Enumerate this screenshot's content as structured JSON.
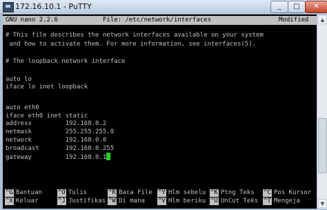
{
  "window": {
    "title": "172.16.10.1 - PuTTY",
    "minimize": "_",
    "maximize": "□",
    "close": "✕"
  },
  "nano_header": {
    "version": "GNU nano 2.2.6",
    "file": "File: /etc/network/interfaces",
    "status": "Modified"
  },
  "editor_lines": [
    "# This file describes the network interfaces available on your system",
    " and how to activate them. For more information, see interfaces(5).",
    "",
    "# The loopback network interface",
    "",
    "auto lo",
    "iface lo inet loopback",
    "",
    "",
    "auto eth0",
    "iface eth0 inet static",
    "address         192.168.0.2",
    "netmask         255.255.255.0",
    "network         192.168.0.0",
    "broadcast       192.168.0.255",
    "gateway         192.168.0.1"
  ],
  "shortcuts_row1": [
    {
      "key": "^G",
      "label": "Bantuan"
    },
    {
      "key": "^O",
      "label": "Tulis"
    },
    {
      "key": "^R",
      "label": "Baca File"
    },
    {
      "key": "^Y",
      "label": "Hlm sebelu"
    },
    {
      "key": "^K",
      "label": "Ptng Teks"
    },
    {
      "key": "^C",
      "label": "Pos Kursor"
    }
  ],
  "shortcuts_row2": [
    {
      "key": "^X",
      "label": "Keluar"
    },
    {
      "key": "^J",
      "label": "Justifikas"
    },
    {
      "key": "^W",
      "label": "Di mana"
    },
    {
      "key": "^V",
      "label": "Hlm beriku"
    },
    {
      "key": "^U",
      "label": "UnCut Teks"
    },
    {
      "key": "^T",
      "label": "Mengeja"
    }
  ],
  "colors": {
    "terminal_bg": "#000000",
    "text": "#c0c0c0",
    "cursor": "#22d022"
  }
}
